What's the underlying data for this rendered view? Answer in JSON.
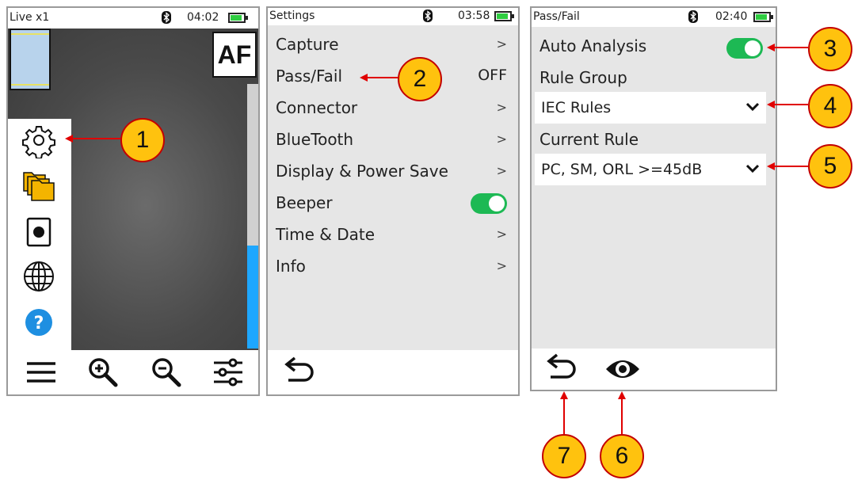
{
  "screen_live": {
    "title": "Live x1",
    "time": "04:02",
    "af_label": "AF",
    "scroll_fill_fraction": 0.39,
    "side_icons": [
      "gear-icon",
      "folders-icon",
      "record-icon",
      "globe-icon",
      "help-icon"
    ],
    "help_glyph": "?",
    "bottom_icons": [
      "menu-icon",
      "zoom-in-icon",
      "zoom-out-icon",
      "sliders-icon"
    ]
  },
  "screen_settings": {
    "title": "Settings",
    "time": "03:58",
    "items": [
      {
        "label": "Capture",
        "right": ">"
      },
      {
        "label": "Pass/Fail",
        "right": "OFF"
      },
      {
        "label": "Connector",
        "right": ">"
      },
      {
        "label": "BlueTooth",
        "right": ">"
      },
      {
        "label": "Display & Power Save",
        "right": ">"
      },
      {
        "label": "Beeper",
        "right": ""
      },
      {
        "label": "Time & Date",
        "right": ">"
      },
      {
        "label": "Info",
        "right": ">"
      }
    ],
    "beeper_on": true,
    "bottom_icons": [
      "back-icon"
    ]
  },
  "screen_passfail": {
    "title": "Pass/Fail",
    "time": "02:40",
    "auto_analysis_label": "Auto Analysis",
    "auto_analysis_on": true,
    "rule_group_label": "Rule Group",
    "rule_group_value": "IEC Rules",
    "current_rule_label": "Current Rule",
    "current_rule_value": "PC, SM, ORL >=45dB",
    "bottom_icons": [
      "back-icon",
      "eye-icon"
    ]
  },
  "callouts": [
    "1",
    "2",
    "3",
    "4",
    "5",
    "6",
    "7"
  ],
  "colors": {
    "callout_fill": "#ffc20e",
    "callout_border": "#c30000",
    "arrow": "#e00000",
    "toggle_on": "#1db954",
    "scroll_fill": "#1ea7ff",
    "battery": "#2ecc40"
  }
}
